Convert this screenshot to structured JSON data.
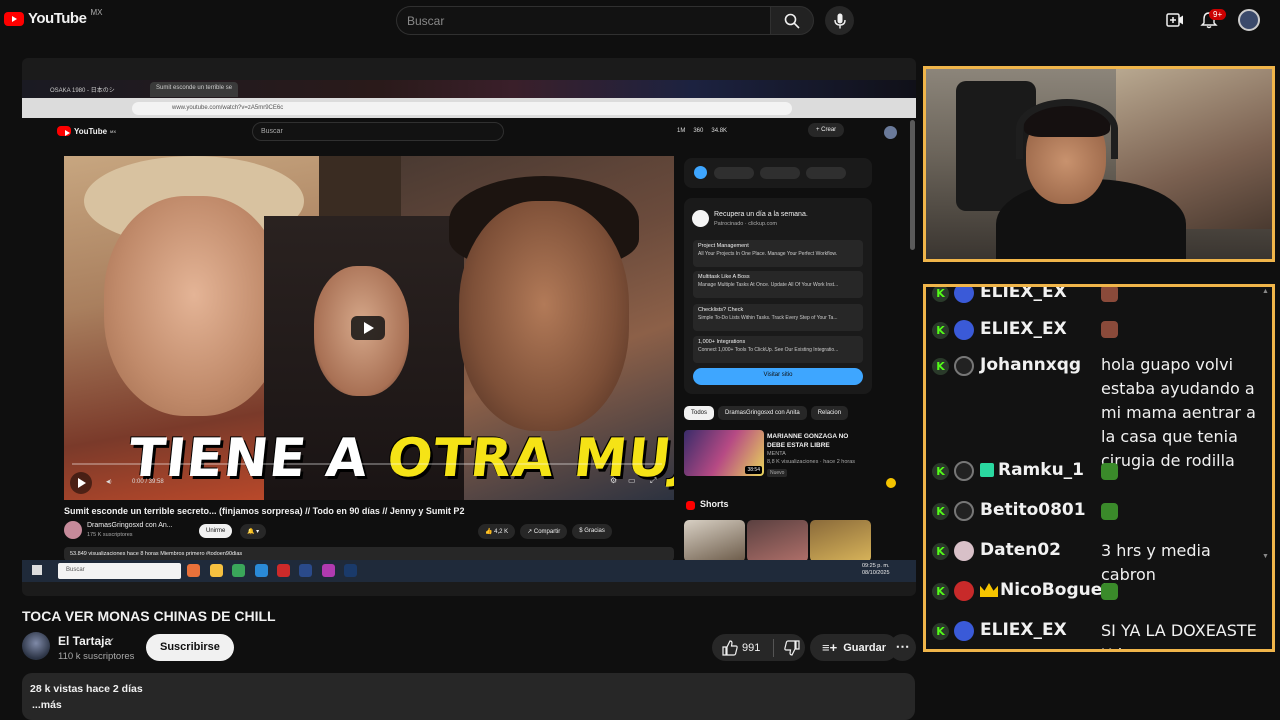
{
  "topbar": {
    "logo_text": "YouTube",
    "region": "MX",
    "search_placeholder": "Buscar",
    "notif_badge": "9+"
  },
  "screen": {
    "tabs": [
      "OSAKA 1980 - 日本のシ",
      "Sumit esconde un terrible se"
    ],
    "url": "www.youtube.com/watch?v=zA5mr9CE6c",
    "inner_logo": "YouTube",
    "inner_region": "MX",
    "inner_search": "Buscar",
    "inner_stats": [
      "1M",
      "360",
      "34.8K"
    ],
    "inner_create": "+ Crear",
    "video_overlay_a": "TIENE A ",
    "video_overlay_b": "OTRA MUJER",
    "time": "0:00 / 39:58",
    "video_title": "Sumit esconde un terrible secreto... (finjamos sorpresa) // Todo en 90 días // Jenny y Sumit P2",
    "channel": "DramasGringosxd con An...",
    "channel_subs": "175 K suscriptores",
    "join_label": "Unirme",
    "actions": [
      "4,2 K",
      "Compartir",
      "Gracias"
    ],
    "desc": "53.849 visualizaciones  hace 8 horas  Miembros primero  #todoen90dias",
    "ad": {
      "title": "Recupera un día a la semana.",
      "sponsor": "Patrocinado · clickup.com",
      "logo": "ClickUp",
      "items": [
        {
          "t": "Project Management",
          "s": "All Your Projects In One Place. Manage Your Perfect Workflow."
        },
        {
          "t": "Multitask Like A Boss",
          "s": "Manage Multiple Tasks At Once. Update All Of Your Work Inst..."
        },
        {
          "t": "Checklists? Check",
          "s": "Simple To-Do Lists Within Tasks. Track Every Step of Your Ta..."
        },
        {
          "t": "1,000+ Integrations",
          "s": "Connect 1,000+ Tools To ClickUp. See Our Existing Integratio..."
        }
      ],
      "visit": "Visitar sitio"
    },
    "chips": [
      "Todos",
      "DramasGringosxd con Anita",
      "Relacion"
    ],
    "rec": {
      "title": "MARIANNE GONZAGA NO DEBE ESTAR LIBRE",
      "channel": "MENTA",
      "meta": "8,8 K visualizaciones · hace 2 horas",
      "badge": "Nuevo",
      "duration": "38:54"
    },
    "shorts_label": "Shorts",
    "taskbar_search": "Buscar",
    "clock_time": "09:25 p. m.",
    "clock_date": "08/10/2025"
  },
  "main": {
    "title": "TOCA VER MONAS CHINAS DE CHILL",
    "channel": "El Tartaja",
    "subs": "110 k suscriptores",
    "subscribe": "Suscribirse",
    "likes": "991",
    "save": "Guardar",
    "views_line": "28 k vistas  hace 2 días",
    "more": "...más"
  },
  "chat": {
    "messages": [
      {
        "user": "ELIEX_EX",
        "msg": "",
        "emote": "face"
      },
      {
        "user": "ELIEX_EX",
        "msg": "",
        "emote": "face"
      },
      {
        "user": "Johannxqg",
        "msg": "hola guapo volvi estaba ayudando a mi mama aentrar a la casa que tenia cirugia de rodilla",
        "emote": ""
      },
      {
        "user": "Ramku_1",
        "msg": "",
        "emote": "frog"
      },
      {
        "user": "Betito0801",
        "msg": "",
        "emote": "frog"
      },
      {
        "user": "Daten02",
        "msg": "3 hrs y media cabron",
        "emote": ""
      },
      {
        "user": "NicoBoguet",
        "msg": "",
        "emote": "frog"
      },
      {
        "user": "ELIEX_EX",
        "msg": "SI YA LA DOXEASTE Xd",
        "emote": ""
      }
    ]
  },
  "colors": {
    "accent": "#f0b54a",
    "kick": "#53fc18",
    "yt_red": "#ff0000"
  }
}
